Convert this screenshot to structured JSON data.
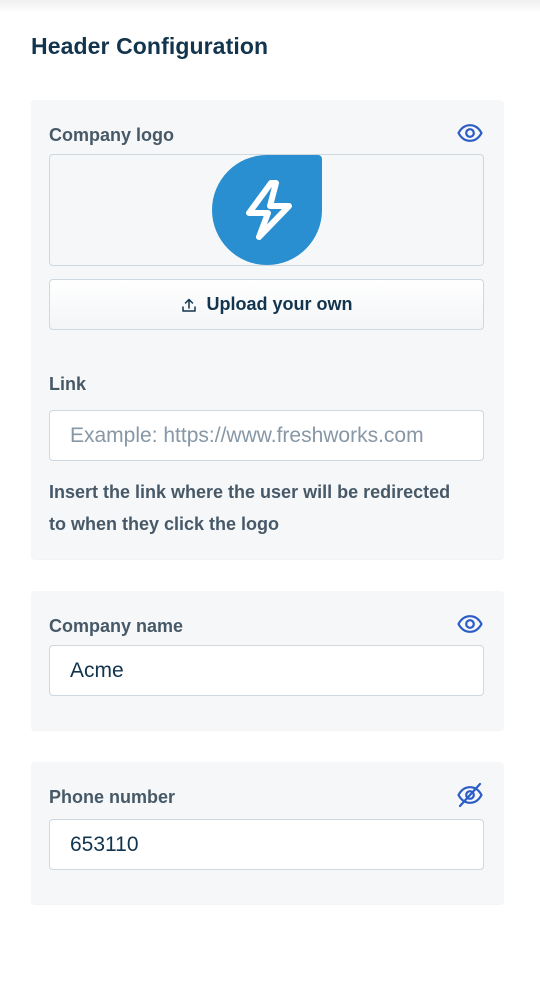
{
  "page": {
    "title": "Header Configuration"
  },
  "logo_section": {
    "label": "Company logo",
    "visibility_icon": "eye-icon",
    "logo_icon": "lightning-bolt-icon",
    "logo_color": "#2a8fd0",
    "upload_icon": "upload-icon",
    "upload_label": "Upload your own",
    "link_label": "Link",
    "link_value": "",
    "link_placeholder": "Example: https://www.freshworks.com",
    "link_help": "Insert the link where the user will be redirected to when they click the logo"
  },
  "name_section": {
    "label": "Company name",
    "visibility_icon": "eye-icon",
    "value": "Acme",
    "placeholder": ""
  },
  "phone_section": {
    "label": "Phone number",
    "visibility_icon": "eye-off-icon",
    "value": "653110",
    "placeholder": ""
  },
  "colors": {
    "accent": "#2c5cc5",
    "heading": "#12344d",
    "label": "#475867",
    "card_bg": "#f5f7f9",
    "border": "#cfd7df"
  }
}
